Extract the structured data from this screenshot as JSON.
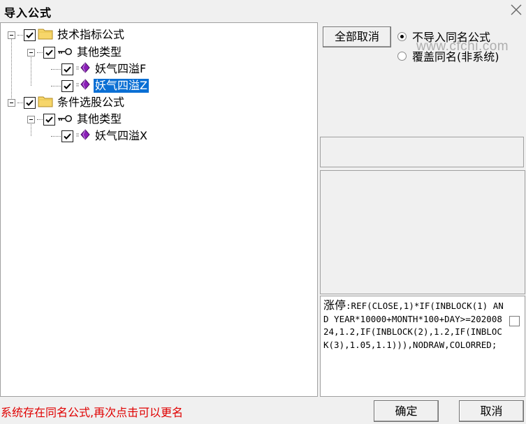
{
  "window": {
    "title": "导入公式"
  },
  "tree": {
    "nodes": [
      {
        "label": "技术指标公式",
        "checked": true,
        "icon": "folder-icon"
      },
      {
        "label": "其他类型",
        "checked": true,
        "icon": "key-icon"
      },
      {
        "label": "妖气四溢F",
        "checked": true,
        "icon": "formula-gem-icon"
      },
      {
        "label": "妖气四溢Z",
        "checked": true,
        "icon": "formula-gem-icon",
        "selected": true
      },
      {
        "label": "条件选股公式",
        "checked": true,
        "icon": "folder-icon"
      },
      {
        "label": "其他类型",
        "checked": true,
        "icon": "key-icon"
      },
      {
        "label": "妖气四溢X",
        "checked": true,
        "icon": "formula-gem-icon"
      }
    ]
  },
  "actions": {
    "cancel_all": "全部取消",
    "confirm": "确定",
    "cancel": "取消"
  },
  "options": {
    "radios": [
      {
        "label": "不导入同名公式",
        "selected": true
      },
      {
        "label": "覆盖同名(非系统)",
        "selected": false
      }
    ]
  },
  "watermark": "www.cfchi.com",
  "formula": {
    "code_head": "涨停",
    "code_body": ":REF(CLOSE,1)*IF(INBLOCK(1) AND YEAR*10000+MONTH*100+DAY>=20200824,1.2,IF(INBLOCK(2),1.2,IF(INBLOCK(3),1.05,1.1))),NODRAW,COLORRED;"
  },
  "status": {
    "message": "系统存在同名公式,再次点击可以更名"
  },
  "colors": {
    "selection": "#0a6fd4",
    "status_text": "#e00000",
    "gem": "#8b1fb8"
  }
}
